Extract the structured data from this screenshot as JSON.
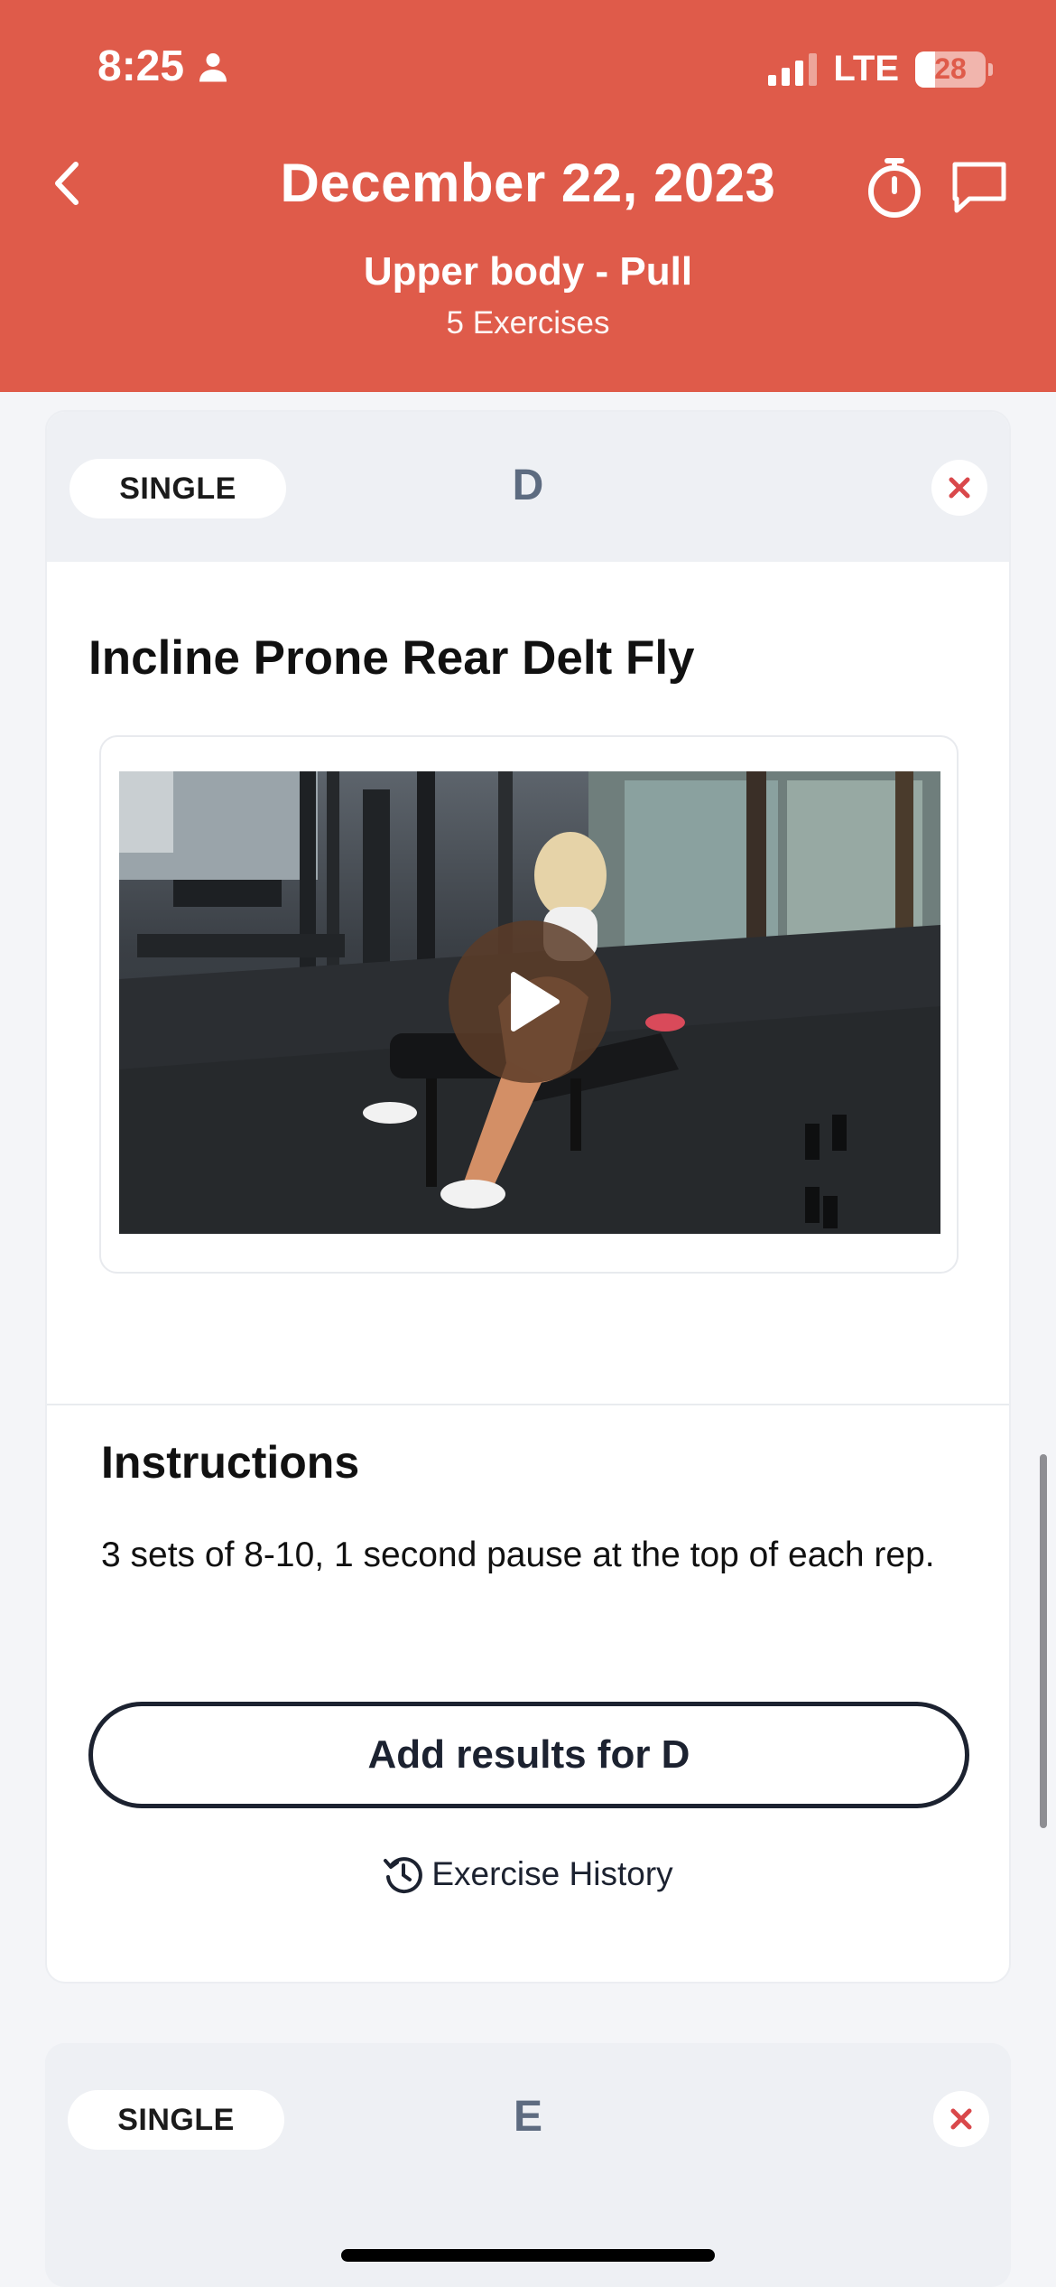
{
  "status_bar": {
    "time": "8:25",
    "network": "LTE",
    "battery": "28",
    "battery_level": 0.28
  },
  "header": {
    "title": "December 22, 2023",
    "workout_name": "Upper body - Pull",
    "exercise_count": "5 Exercises",
    "icons": [
      "chevron-left-icon",
      "stopwatch-icon",
      "chat-bubble-icon"
    ],
    "background": "#df5b4a"
  },
  "cards": [
    {
      "type_label": "SINGLE",
      "letter": "D",
      "exercise_title": "Incline Prone Rear Delt Fly",
      "instructions_title": "Instructions",
      "instructions_text": "3 sets of 8-10, 1 second pause at the top of each rep.",
      "add_results_label": "Add results for D",
      "history_label": "Exercise History"
    },
    {
      "type_label": "SINGLE",
      "letter": "E"
    }
  ],
  "colors": {
    "accent": "#df5b4a",
    "close_icon": "#d9484b",
    "letter": "#5d6b80",
    "button_border": "#1c2230"
  }
}
